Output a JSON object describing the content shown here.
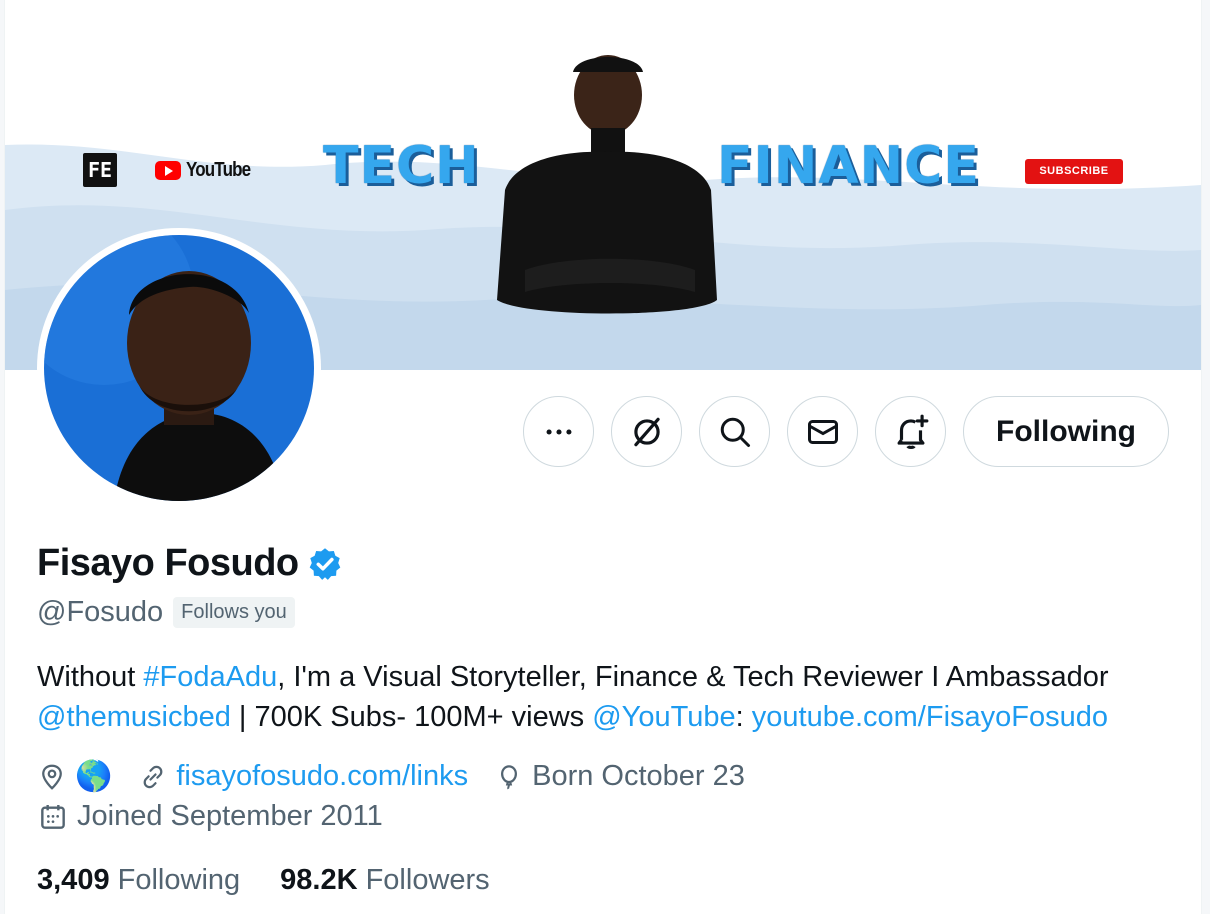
{
  "banner": {
    "logo_glyph": "FE",
    "youtube_text": "YouTube",
    "word_left": "TECH",
    "word_right": "FINANCE",
    "subscribe_label": "SUBSCRIBE"
  },
  "actions": {
    "more_icon": "more-horizontal-icon",
    "grok_icon": "grok-icon",
    "search_icon": "search-icon",
    "message_icon": "envelope-icon",
    "notify_icon": "bell-plus-icon",
    "following_label": "Following"
  },
  "profile": {
    "name": "Fisayo Fosudo",
    "verified_icon": "verified-badge-icon",
    "handle": "@Fosudo",
    "follows_you": "Follows you",
    "bio": {
      "p1": "Without ",
      "hashtag": "#FodaAdu",
      "p2": ", I'm a Visual Storyteller, Finance & Tech Reviewer I Ambassador",
      "mention1": "@themusicbed",
      "p3": " | 700K Subs- 100M+ views ",
      "mention2": "@YouTube",
      "p4": ": ",
      "url": "youtube.com/FisayoFosudo"
    },
    "location_emoji": "🌎",
    "website": "fisayofosudo.com/links",
    "birthday": "Born October 23",
    "joined": "Joined September 2011"
  },
  "stats": {
    "following_count": "3,409",
    "following_label": "Following",
    "followers_count": "98.2K",
    "followers_label": "Followers"
  },
  "colors": {
    "accent": "#1d9bf0",
    "text": "#0f1419",
    "muted": "#536471",
    "border": "#cfd9de",
    "avatar_bg": "#1a6fd6",
    "banner_word": "#35a7ee",
    "subscribe": "#e31212"
  }
}
